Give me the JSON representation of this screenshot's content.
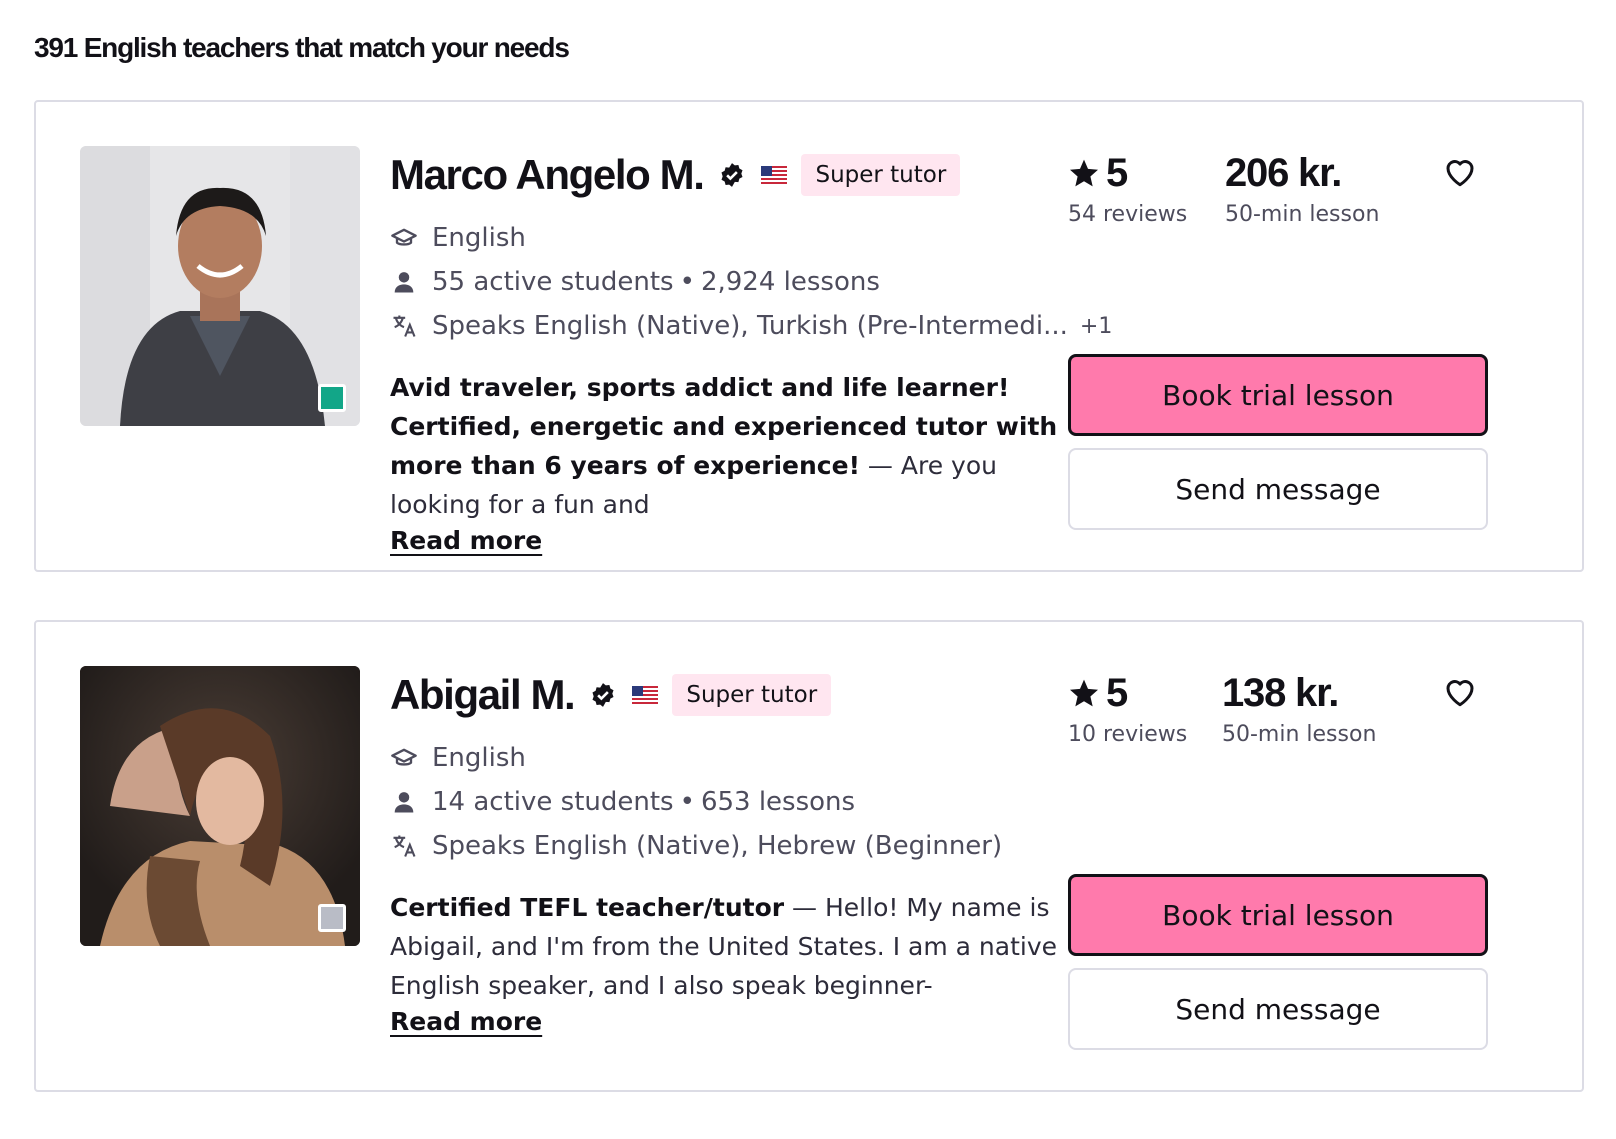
{
  "header": {
    "results_title": "391 English teachers that match your needs"
  },
  "tutors": [
    {
      "name": "Marco Angelo M.",
      "badge": "Super tutor",
      "subject": "English",
      "active_students": "55 active students",
      "lessons": "2,924 lessons",
      "speaks": "Speaks English (Native), Turkish (Pre-Intermedi...",
      "speaks_more": "+1",
      "headline": "Avid traveler, sports addict and life learner! Certified, energetic and experienced tutor with more than 6 years of experience!",
      "separator": " — ",
      "description": "Are you looking for a fun and",
      "read_more": "Read more",
      "rating": "5",
      "reviews": "54 reviews",
      "price": "206 kr.",
      "price_unit": "50-min lesson",
      "book_label": "Book trial lesson",
      "message_label": "Send message",
      "online": true
    },
    {
      "name": "Abigail M.",
      "badge": "Super tutor",
      "subject": "English",
      "active_students": "14 active students",
      "lessons": "653 lessons",
      "speaks": "Speaks English (Native), Hebrew (Beginner)",
      "speaks_more": "",
      "headline": "Certified TEFL teacher/tutor",
      "separator": " — ",
      "description": "Hello! My name is Abigail, and I'm from the United States. I am a native English speaker, and I also speak beginner-",
      "read_more": "Read more",
      "rating": "5",
      "reviews": "10 reviews",
      "price": "138 kr.",
      "price_unit": "50-min lesson",
      "book_label": "Book trial lesson",
      "message_label": "Send message",
      "online": false
    }
  ],
  "icons": {
    "verified": "verified-check-icon",
    "flag": "us-flag-icon",
    "subject": "graduation-cap-icon",
    "students": "person-icon",
    "languages": "translate-icon",
    "rating": "star-icon",
    "favorite": "heart-outline-icon"
  },
  "colors": {
    "primary_button": "#ff7aac",
    "super_badge_bg": "#ffe6f0",
    "online_status": "#12a688",
    "offline_status": "#b9bcc6",
    "card_border": "#dcdce5",
    "text_primary": "#121117",
    "text_secondary": "#4d4c5c"
  }
}
